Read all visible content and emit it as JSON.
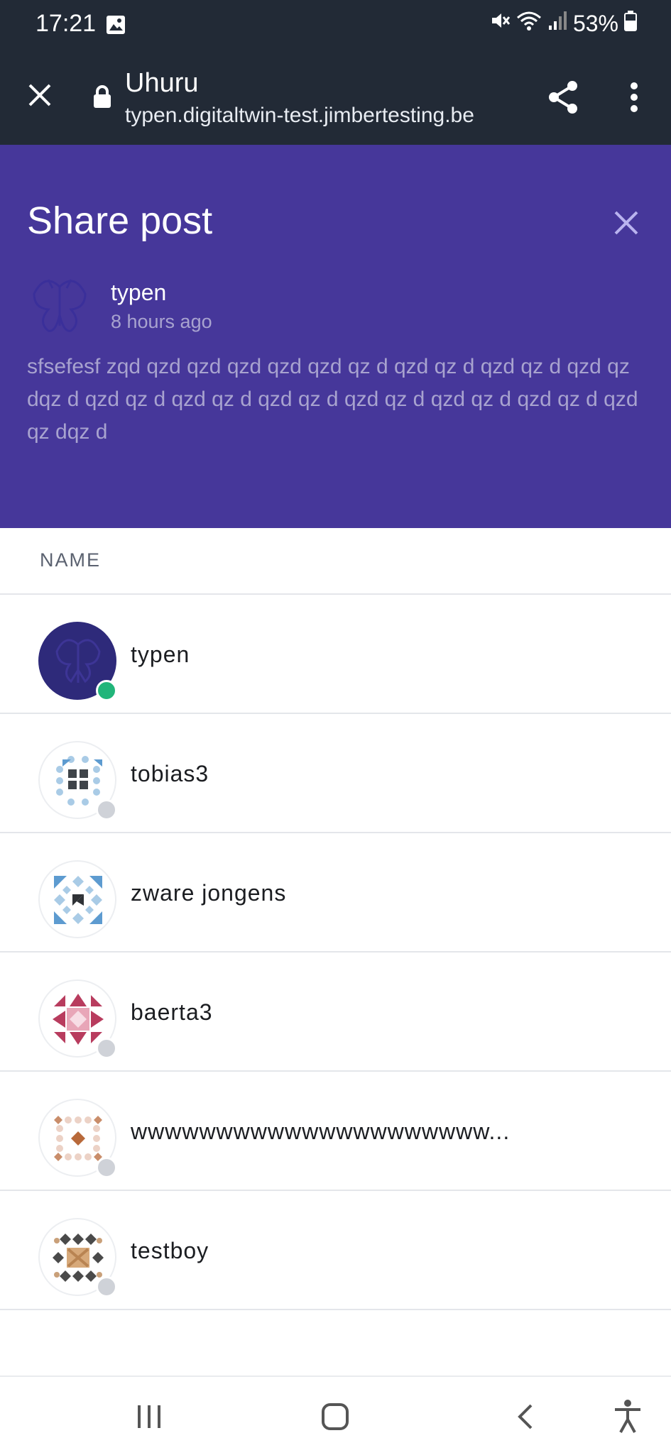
{
  "status_bar": {
    "time": "17:21",
    "battery": "53%"
  },
  "browser": {
    "title": "Uhuru",
    "url": "typen.digitaltwin-test.jimbertesting.be"
  },
  "share_post": {
    "title": "Share post",
    "post": {
      "author": "typen",
      "time": "8 hours ago",
      "text": "sfsefesf zqd qzd qzd qzd qzd qzd qz d qzd qz d qzd qz d qzd qz dqz d qzd qz d qzd qz d qzd qz d qzd qz d qzd qz d qzd qz d qzd qz dqz d"
    }
  },
  "contacts": {
    "header": "NAME",
    "items": [
      {
        "name": "typen",
        "status": "online"
      },
      {
        "name": "tobias3",
        "status": "offline"
      },
      {
        "name": "zware jongens",
        "status": "none"
      },
      {
        "name": "baerta3",
        "status": "offline"
      },
      {
        "name": "wwwwwwwwwwwwwwwwwwwww...",
        "status": "offline"
      },
      {
        "name": "testboy",
        "status": "offline"
      }
    ]
  },
  "colors": {
    "browser_bar": "#222a36",
    "share_panel": "#46379a",
    "online": "#21b57a",
    "offline": "#cfd2d8"
  },
  "icons": [
    "gallery-icon",
    "mute-icon",
    "wifi-icon",
    "signal-icon",
    "battery-icon",
    "close-icon",
    "lock-icon",
    "share-icon",
    "more-vert-icon",
    "recent-apps-icon",
    "home-icon",
    "back-icon",
    "accessibility-icon"
  ]
}
